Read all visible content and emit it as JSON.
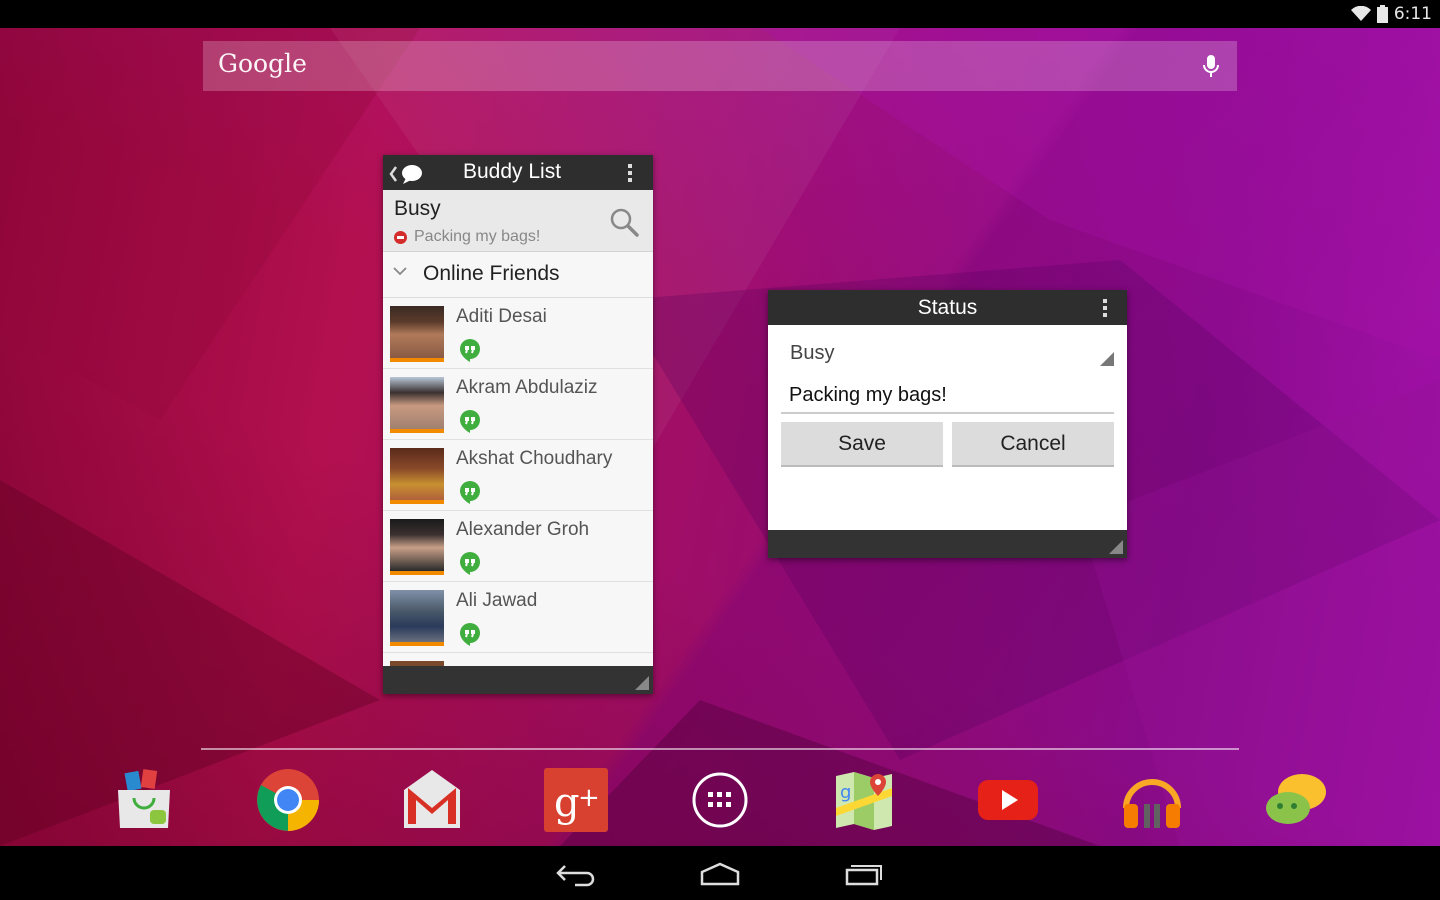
{
  "status_bar": {
    "time": "6:11"
  },
  "search_bar": {
    "logo": "Google"
  },
  "buddy_list": {
    "title": "Buddy List",
    "my_status": "Busy",
    "my_message": "Packing my bags!",
    "group": "Online Friends",
    "friends": [
      {
        "name": "Aditi Desai"
      },
      {
        "name": "Akram Abdulaziz"
      },
      {
        "name": "Akshat Choudhary"
      },
      {
        "name": "Alexander Groh"
      },
      {
        "name": "Ali Jawad"
      }
    ]
  },
  "status_widget": {
    "title": "Status",
    "selected_status": "Busy",
    "message_value": "Packing my bags!",
    "save_label": "Save",
    "cancel_label": "Cancel"
  },
  "dock": {
    "icons": [
      "play-store-icon",
      "chrome-icon",
      "gmail-icon",
      "google-plus-icon",
      "app-drawer-icon",
      "maps-icon",
      "youtube-icon",
      "play-music-icon",
      "im-app-icon"
    ]
  },
  "colors": {
    "accent_orange": "#f28a00",
    "busy_red": "#d42b2b",
    "hangouts_green": "#3fae3f"
  }
}
